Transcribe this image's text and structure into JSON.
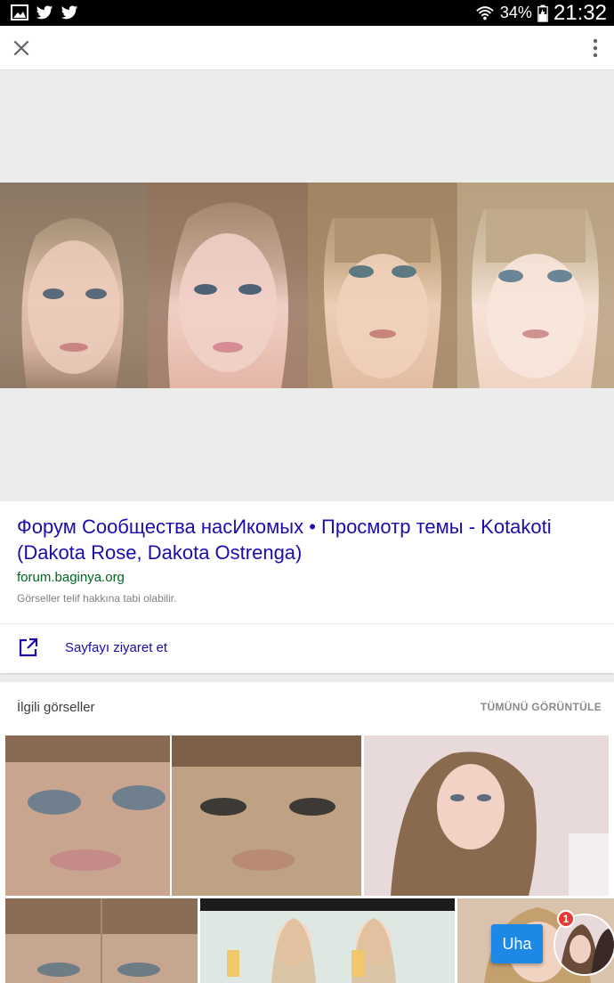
{
  "status_bar": {
    "battery_percent": "34%",
    "time": "21:32",
    "left_icons": [
      "gallery-icon",
      "twitter-icon",
      "twitter-icon"
    ],
    "right_icons": [
      "wifi-icon",
      "battery-icon"
    ]
  },
  "toolbar": {
    "close_icon": "close-icon",
    "menu_icon": "more-vert-icon"
  },
  "result": {
    "title": "Форум Сообщества насИкомых • Просмотр темы - Kotakoti (Dakota Rose, Dakota Ostrenga)",
    "domain": "forum.baginya.org",
    "copyright_note": "Görseller telif hakkına tabi olabilir.",
    "visit_label": "Sayfayı ziyaret et"
  },
  "related": {
    "header": "İlgili görseller",
    "view_all": "TÜMÜNÜ GÖRÜNTÜLE"
  },
  "chat": {
    "button_label": "Uha",
    "badge_count": "1"
  },
  "colors": {
    "link_blue": "#1a0dab",
    "url_green": "#006621",
    "fab_blue": "#1e88e5",
    "badge_red": "#e53935"
  }
}
